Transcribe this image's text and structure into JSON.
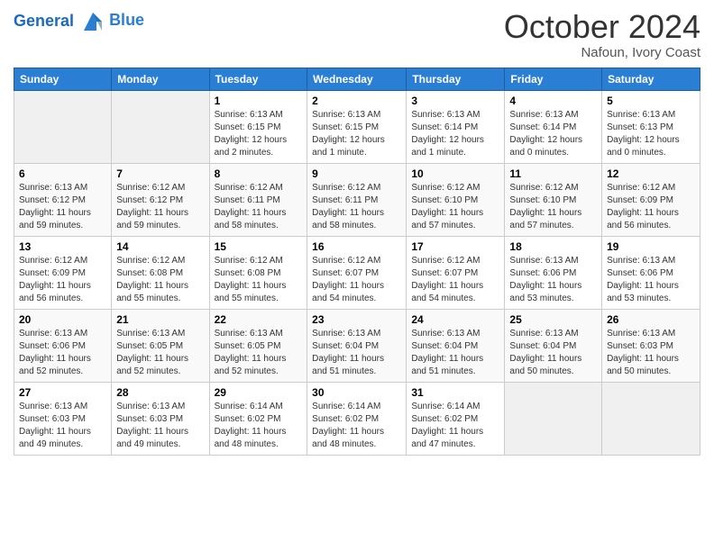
{
  "header": {
    "logo_line1": "General",
    "logo_line2": "Blue",
    "month_title": "October 2024",
    "location": "Nafoun, Ivory Coast"
  },
  "weekdays": [
    "Sunday",
    "Monday",
    "Tuesday",
    "Wednesday",
    "Thursday",
    "Friday",
    "Saturday"
  ],
  "weeks": [
    [
      {
        "day": "",
        "info": ""
      },
      {
        "day": "",
        "info": ""
      },
      {
        "day": "1",
        "info": "Sunrise: 6:13 AM\nSunset: 6:15 PM\nDaylight: 12 hours\nand 2 minutes."
      },
      {
        "day": "2",
        "info": "Sunrise: 6:13 AM\nSunset: 6:15 PM\nDaylight: 12 hours\nand 1 minute."
      },
      {
        "day": "3",
        "info": "Sunrise: 6:13 AM\nSunset: 6:14 PM\nDaylight: 12 hours\nand 1 minute."
      },
      {
        "day": "4",
        "info": "Sunrise: 6:13 AM\nSunset: 6:14 PM\nDaylight: 12 hours\nand 0 minutes."
      },
      {
        "day": "5",
        "info": "Sunrise: 6:13 AM\nSunset: 6:13 PM\nDaylight: 12 hours\nand 0 minutes."
      }
    ],
    [
      {
        "day": "6",
        "info": "Sunrise: 6:13 AM\nSunset: 6:12 PM\nDaylight: 11 hours\nand 59 minutes."
      },
      {
        "day": "7",
        "info": "Sunrise: 6:12 AM\nSunset: 6:12 PM\nDaylight: 11 hours\nand 59 minutes."
      },
      {
        "day": "8",
        "info": "Sunrise: 6:12 AM\nSunset: 6:11 PM\nDaylight: 11 hours\nand 58 minutes."
      },
      {
        "day": "9",
        "info": "Sunrise: 6:12 AM\nSunset: 6:11 PM\nDaylight: 11 hours\nand 58 minutes."
      },
      {
        "day": "10",
        "info": "Sunrise: 6:12 AM\nSunset: 6:10 PM\nDaylight: 11 hours\nand 57 minutes."
      },
      {
        "day": "11",
        "info": "Sunrise: 6:12 AM\nSunset: 6:10 PM\nDaylight: 11 hours\nand 57 minutes."
      },
      {
        "day": "12",
        "info": "Sunrise: 6:12 AM\nSunset: 6:09 PM\nDaylight: 11 hours\nand 56 minutes."
      }
    ],
    [
      {
        "day": "13",
        "info": "Sunrise: 6:12 AM\nSunset: 6:09 PM\nDaylight: 11 hours\nand 56 minutes."
      },
      {
        "day": "14",
        "info": "Sunrise: 6:12 AM\nSunset: 6:08 PM\nDaylight: 11 hours\nand 55 minutes."
      },
      {
        "day": "15",
        "info": "Sunrise: 6:12 AM\nSunset: 6:08 PM\nDaylight: 11 hours\nand 55 minutes."
      },
      {
        "day": "16",
        "info": "Sunrise: 6:12 AM\nSunset: 6:07 PM\nDaylight: 11 hours\nand 54 minutes."
      },
      {
        "day": "17",
        "info": "Sunrise: 6:12 AM\nSunset: 6:07 PM\nDaylight: 11 hours\nand 54 minutes."
      },
      {
        "day": "18",
        "info": "Sunrise: 6:13 AM\nSunset: 6:06 PM\nDaylight: 11 hours\nand 53 minutes."
      },
      {
        "day": "19",
        "info": "Sunrise: 6:13 AM\nSunset: 6:06 PM\nDaylight: 11 hours\nand 53 minutes."
      }
    ],
    [
      {
        "day": "20",
        "info": "Sunrise: 6:13 AM\nSunset: 6:06 PM\nDaylight: 11 hours\nand 52 minutes."
      },
      {
        "day": "21",
        "info": "Sunrise: 6:13 AM\nSunset: 6:05 PM\nDaylight: 11 hours\nand 52 minutes."
      },
      {
        "day": "22",
        "info": "Sunrise: 6:13 AM\nSunset: 6:05 PM\nDaylight: 11 hours\nand 52 minutes."
      },
      {
        "day": "23",
        "info": "Sunrise: 6:13 AM\nSunset: 6:04 PM\nDaylight: 11 hours\nand 51 minutes."
      },
      {
        "day": "24",
        "info": "Sunrise: 6:13 AM\nSunset: 6:04 PM\nDaylight: 11 hours\nand 51 minutes."
      },
      {
        "day": "25",
        "info": "Sunrise: 6:13 AM\nSunset: 6:04 PM\nDaylight: 11 hours\nand 50 minutes."
      },
      {
        "day": "26",
        "info": "Sunrise: 6:13 AM\nSunset: 6:03 PM\nDaylight: 11 hours\nand 50 minutes."
      }
    ],
    [
      {
        "day": "27",
        "info": "Sunrise: 6:13 AM\nSunset: 6:03 PM\nDaylight: 11 hours\nand 49 minutes."
      },
      {
        "day": "28",
        "info": "Sunrise: 6:13 AM\nSunset: 6:03 PM\nDaylight: 11 hours\nand 49 minutes."
      },
      {
        "day": "29",
        "info": "Sunrise: 6:14 AM\nSunset: 6:02 PM\nDaylight: 11 hours\nand 48 minutes."
      },
      {
        "day": "30",
        "info": "Sunrise: 6:14 AM\nSunset: 6:02 PM\nDaylight: 11 hours\nand 48 minutes."
      },
      {
        "day": "31",
        "info": "Sunrise: 6:14 AM\nSunset: 6:02 PM\nDaylight: 11 hours\nand 47 minutes."
      },
      {
        "day": "",
        "info": ""
      },
      {
        "day": "",
        "info": ""
      }
    ]
  ]
}
